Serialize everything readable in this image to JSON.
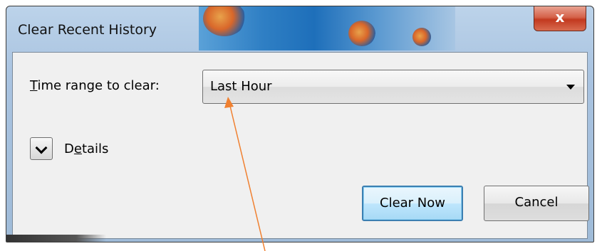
{
  "window": {
    "title": "Clear Recent History",
    "close_glyph": "x"
  },
  "form": {
    "time_range_label_prefix": "T",
    "time_range_label_rest": "ime range to clear:",
    "time_range_value": "Last Hour",
    "details_label_prefix": "D",
    "details_label_accel": "e",
    "details_label_rest": "tails"
  },
  "buttons": {
    "clear_now": "Clear Now",
    "cancel": "Cancel"
  },
  "colors": {
    "annotation_arrow": "#f08030",
    "default_button_border": "#3c7fb1"
  },
  "icons": {
    "select_arrow": "triangle-down",
    "details_toggle": "chevron-down",
    "close": "x"
  }
}
